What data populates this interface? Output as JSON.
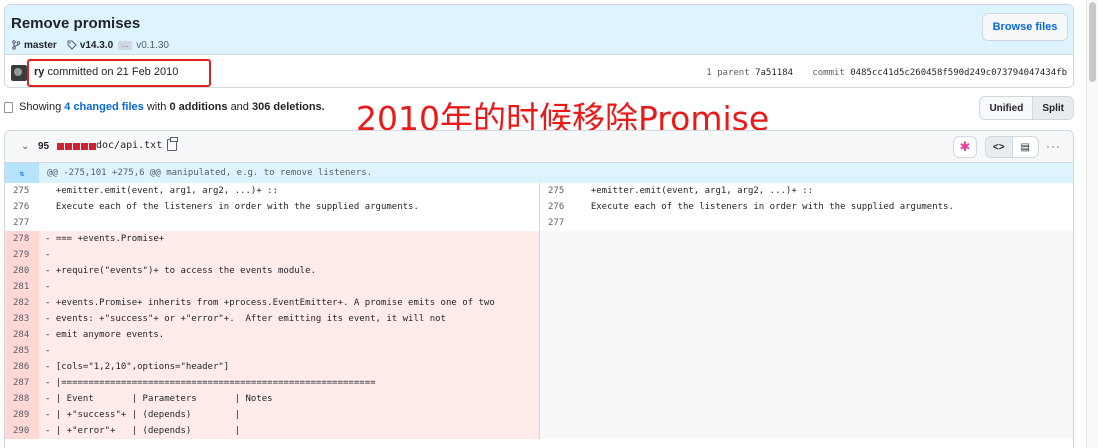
{
  "commit": {
    "title": "Remove promises",
    "branch": "master",
    "tag": "v14.3.0",
    "ellipsis": "…",
    "tag2": "v0.1.30",
    "browse_label": "Browse files",
    "author": "ry",
    "authored_text": "committed on 21 Feb 2010",
    "parent_label": "1 parent",
    "parent_sha": "7a51184",
    "commit_label": "commit",
    "commit_sha": "0485cc41d5c260458f590d249c073794047434fb"
  },
  "summary": {
    "showing": "Showing",
    "changed_files": "4 changed files",
    "with": "with",
    "additions": "0 additions",
    "and": "and",
    "deletions": "306 deletions."
  },
  "overlay_text": "2010年的时候移除Promise",
  "view_toggle": {
    "unified": "Unified",
    "split": "Split"
  },
  "file": {
    "deletion_count": "95",
    "diffstat_blocks": 5,
    "diffstat_color": "#cf222e",
    "path": "doc/api.txt",
    "hunk_header": "@@ -275,101 +275,6 @@ manipulated, e.g. to remove listeners.",
    "hunk_expand_icon": "expand-icon",
    "more_icon": "···"
  },
  "diff_rows": [
    {
      "type": "ctx",
      "left_ln": "275",
      "left": "  +emitter.emit(event, arg1, arg2, ...)+ ::",
      "right_ln": "275",
      "right": "  +emitter.emit(event, arg1, arg2, ...)+ ::"
    },
    {
      "type": "ctx",
      "left_ln": "276",
      "left": "  Execute each of the listeners in order with the supplied arguments.",
      "right_ln": "276",
      "right": "  Execute each of the listeners in order with the supplied arguments."
    },
    {
      "type": "ctx",
      "left_ln": "277",
      "left": "",
      "right_ln": "277",
      "right": ""
    },
    {
      "type": "del",
      "left_ln": "278",
      "left": "- === +events.Promise+"
    },
    {
      "type": "del",
      "left_ln": "279",
      "left": "-"
    },
    {
      "type": "del",
      "left_ln": "280",
      "left": "- +require(\"events\")+ to access the events module."
    },
    {
      "type": "del",
      "left_ln": "281",
      "left": "-"
    },
    {
      "type": "del",
      "left_ln": "282",
      "left": "- +events.Promise+ inherits from +process.EventEmitter+. A promise emits one of two"
    },
    {
      "type": "del",
      "left_ln": "283",
      "left": "- events: +\"success\"+ or +\"error\"+.  After emitting its event, it will not"
    },
    {
      "type": "del",
      "left_ln": "284",
      "left": "- emit anymore events."
    },
    {
      "type": "del",
      "left_ln": "285",
      "left": "-"
    },
    {
      "type": "del",
      "left_ln": "286",
      "left": "- [cols=\"1,2,10\",options=\"header\"]"
    },
    {
      "type": "del",
      "left_ln": "287",
      "left": "- |=========================================================="
    },
    {
      "type": "del",
      "left_ln": "288",
      "left": "- | Event       | Parameters       | Notes"
    },
    {
      "type": "del",
      "left_ln": "289",
      "left": "- | +\"success\"+ | (depends)        |"
    },
    {
      "type": "del",
      "left_ln": "290",
      "left": "- | +\"error\"+   | (depends)        |"
    }
  ]
}
